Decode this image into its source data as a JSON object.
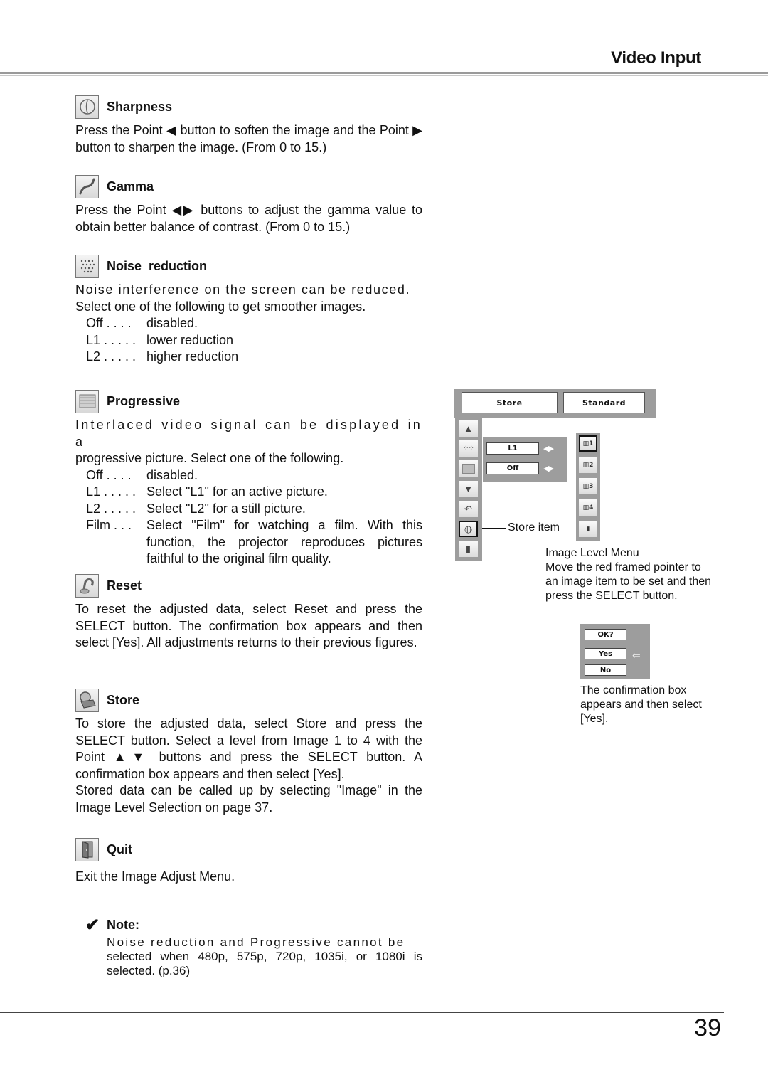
{
  "header": {
    "title": "Video Input"
  },
  "sections": {
    "sharpness": {
      "title": "Sharpness",
      "icon": "sharpness-icon",
      "text": "Press the Point ◀ button to soften the image and the Point ▶ button to sharpen the image. (From 0 to 15.)"
    },
    "gamma": {
      "title": "Gamma",
      "icon": "gamma-curve-icon",
      "text": "Press the Point ◀▶ buttons to adjust the gamma value to obtain better balance of contrast. (From 0 to 15.)"
    },
    "noise": {
      "title": "Noise  reduction",
      "icon": "noise-dots-icon",
      "text_1": "Noise interference on the screen can be reduced.",
      "text_2": "Select one of the following to get smoother images.",
      "options": [
        {
          "key": "Off . . . .",
          "desc": "disabled."
        },
        {
          "key": "L1 . . . . .",
          "desc": "lower reduction"
        },
        {
          "key": "L2 . . . . .",
          "desc": "higher reduction"
        }
      ]
    },
    "progressive": {
      "title": "Progressive",
      "icon": "progressive-screen-icon",
      "text_1": "Interlaced video signal can be displayed in a",
      "text_2": "progressive picture.  Select one of the following.",
      "options": [
        {
          "key": "Off . . . .",
          "desc": "disabled."
        },
        {
          "key": "L1 . . . . .",
          "desc": "Select \"L1\" for an active picture."
        },
        {
          "key": "L2 . . . . .",
          "desc": "Select \"L2\" for a still picture."
        },
        {
          "key": "Film . . .",
          "desc": "Select \"Film\" for watching a film. With this function, the projector reproduces pictures faithful to the original film quality."
        }
      ]
    },
    "reset": {
      "title": "Reset",
      "icon": "reset-arrow-icon",
      "text": "To reset the adjusted data, select Reset and press the SELECT button.  The confirmation box appears and then select [Yes].  All adjustments returns to their previous figures."
    },
    "store": {
      "title": "Store",
      "icon": "store-icon",
      "text_1": "To store the adjusted data, select Store and press the SELECT button.  Select a level from Image 1 to 4 with the Point ▲▼ buttons and press the SELECT button.  A confirmation box appears and then select [Yes].",
      "text_2": "Stored data can be called up by selecting \"Image\" in the Image Level Selection on page 37."
    },
    "quit": {
      "title": "Quit",
      "icon": "quit-door-icon",
      "text": "Exit the Image Adjust Menu."
    }
  },
  "note": {
    "check": "✔",
    "title": "Note:",
    "line_1": "Noise reduction and Progressive cannot be",
    "line_2": "selected when 480p, 575p, 720p, 1035i, or 1080i is selected. (p.36)"
  },
  "menu_figure": {
    "top_buttons": [
      "Store",
      "Standard"
    ],
    "left_icons": [
      "sharpness-icon",
      "noise-icon",
      "progressive-icon",
      "down-arrow-icon",
      "reset-icon",
      "store-icon",
      "quit-icon"
    ],
    "left_selected": "store-icon",
    "fields": [
      {
        "value": "L1",
        "arrows": "◀▶"
      },
      {
        "value": "Off",
        "arrows": "◀▶"
      }
    ],
    "image_levels": [
      "1",
      "2",
      "3",
      "4"
    ],
    "image_level_selected": "1",
    "store_item_label": "Store item",
    "caption_title": "Image Level Menu",
    "caption_text": "Move the red framed pointer to an image item to be set and then press the SELECT button."
  },
  "confirm_figure": {
    "title": "OK?",
    "yes": "Yes",
    "no": "No",
    "pointer": "⇐",
    "caption": "The confirmation box appears and then select [Yes]."
  },
  "footer": {
    "page_number": "39"
  }
}
